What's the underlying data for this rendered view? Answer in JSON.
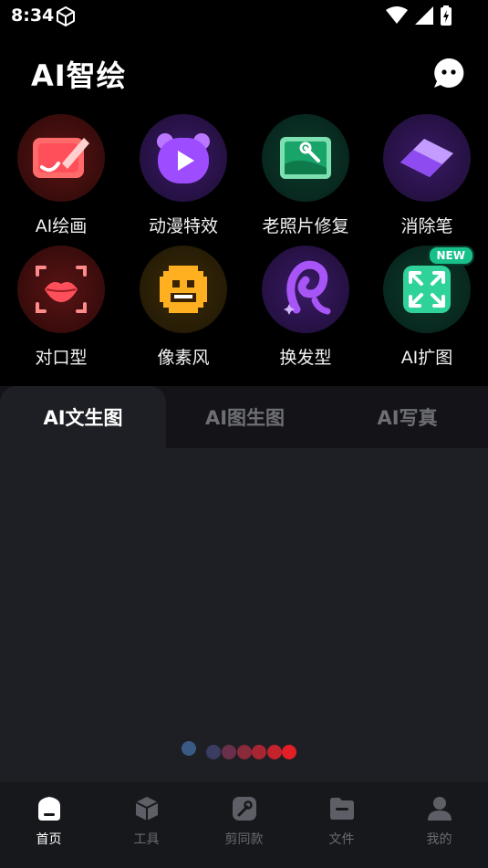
{
  "status_bar": {
    "time": "8:34"
  },
  "header": {
    "app_title": "AI智绘"
  },
  "tools": [
    {
      "label": "AI绘画",
      "icon": "paint-canvas-icon"
    },
    {
      "label": "动漫特效",
      "icon": "anime-bear-icon"
    },
    {
      "label": "老照片修复",
      "icon": "photo-repair-icon"
    },
    {
      "label": "消除笔",
      "icon": "eraser-icon"
    },
    {
      "label": "对口型",
      "icon": "lips-icon"
    },
    {
      "label": "像素风",
      "icon": "pixel-face-icon"
    },
    {
      "label": "换发型",
      "icon": "hairstyle-icon"
    },
    {
      "label": "AI扩图",
      "icon": "expand-image-icon",
      "badge": "NEW"
    }
  ],
  "tabs": [
    {
      "label": "AI文生图",
      "active": true
    },
    {
      "label": "AI图生图",
      "active": false
    },
    {
      "label": "AI写真",
      "active": false
    }
  ],
  "bottom_nav": [
    {
      "label": "首页",
      "icon": "home-icon",
      "active": true
    },
    {
      "label": "工具",
      "icon": "tools-icon",
      "active": false
    },
    {
      "label": "剪同款",
      "icon": "edit-template-icon",
      "active": false
    },
    {
      "label": "文件",
      "icon": "folder-icon",
      "active": false
    },
    {
      "label": "我的",
      "icon": "profile-icon",
      "active": false
    }
  ]
}
